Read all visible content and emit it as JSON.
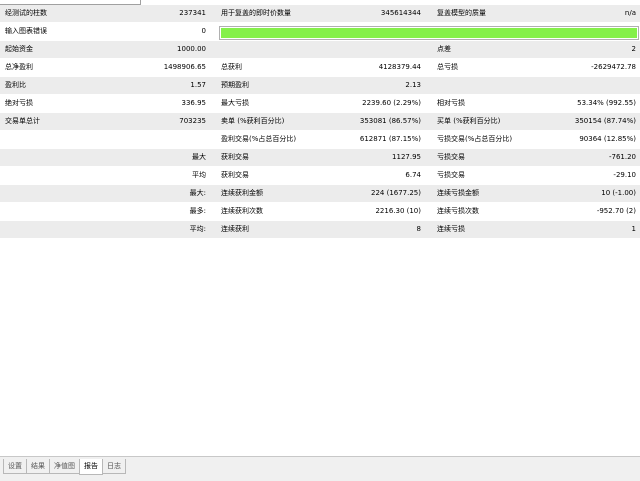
{
  "window": {
    "title": ""
  },
  "progress": {
    "fill_fraction": 1.0,
    "color": "#85f04a"
  },
  "rows": [
    {
      "bg": "g",
      "c1": "经测试的柱数",
      "v1": "237341",
      "c2": "用于复盖的即时价数量",
      "v2": "345614344",
      "c3": "复盖模型的质量",
      "v3": "n/a"
    },
    {
      "bg": "w",
      "c1": "输入图表错误",
      "v1": "0"
    },
    {
      "bg": "g",
      "c1": "起始资金",
      "v1": "1000.00",
      "c2": "",
      "v2": "",
      "c3": "点差",
      "v3": "2"
    },
    {
      "bg": "w",
      "c1": "总净盈利",
      "v1": "1498906.65",
      "c2": "总获利",
      "v2": "4128379.44",
      "c3": "总亏损",
      "v3": "-2629472.78"
    },
    {
      "bg": "g",
      "c1": "盈利比",
      "v1": "1.57",
      "c2": "预期盈利",
      "v2": "2.13",
      "c3": "",
      "v3": ""
    },
    {
      "bg": "w",
      "c1": "绝对亏损",
      "v1": "336.95",
      "c2": "最大亏损",
      "v2": "2239.60 (2.29%)",
      "c3": "相对亏损",
      "v3": "53.34% (992.55)"
    },
    {
      "bg": "g",
      "c1": "交易单总计",
      "v1": "703235",
      "c2": "卖单 (%获利百分比)",
      "v2": "353081 (86.57%)",
      "c3": "买单 (%获利百分比)",
      "v3": "350154 (87.74%)"
    },
    {
      "bg": "w",
      "c1": "",
      "v1": "",
      "c2": "盈利交易(%占总百分比)",
      "v2": "612871 (87.15%)",
      "c3": "亏损交易(%占总百分比)",
      "v3": "90364 (12.85%)"
    },
    {
      "bg": "g",
      "c1": "",
      "lab1": "最大",
      "c2": "获利交易",
      "v2": "1127.95",
      "c3": "亏损交易",
      "v3": "-761.20"
    },
    {
      "bg": "w",
      "c1": "",
      "lab1": "平均",
      "c2": "获利交易",
      "v2": "6.74",
      "c3": "亏损交易",
      "v3": "-29.10"
    },
    {
      "bg": "g",
      "c1": "",
      "lab1": "最大:",
      "c2": "连续获利金额",
      "v2": "224 (1677.25)",
      "c3": "连续亏损金额",
      "v3": "10 (-1.00)"
    },
    {
      "bg": "w",
      "c1": "",
      "lab1": "最多:",
      "c2": "连续获利次数",
      "v2": "2216.30 (10)",
      "c3": "连续亏损次数",
      "v3": "-952.70 (2)"
    },
    {
      "bg": "g",
      "c1": "",
      "lab1": "平均:",
      "c2": "连续获利",
      "v2": "8",
      "c3": "连续亏损",
      "v3": "1"
    }
  ],
  "tabs": [
    {
      "label": "设置",
      "active": false
    },
    {
      "label": "结果",
      "active": false
    },
    {
      "label": "净值图",
      "active": false
    },
    {
      "label": "报告",
      "active": true
    },
    {
      "label": "日志",
      "active": false
    }
  ]
}
